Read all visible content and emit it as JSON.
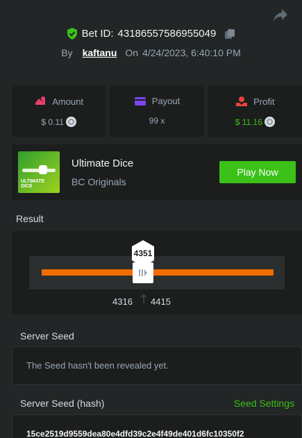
{
  "header": {
    "bet_id_label": "Bet ID:",
    "bet_id": "43186557586955049",
    "by_label": "By",
    "username": "kaftanu",
    "on_label": "On",
    "datetime": "4/24/2023, 6:40:10 PM"
  },
  "stats": [
    {
      "label": "Amount",
      "value": "$ 0.11",
      "icon": "amount-icon"
    },
    {
      "label": "Payout",
      "value": "99 x",
      "icon": "payout-icon"
    },
    {
      "label": "Profit",
      "value": "$ 11.16",
      "icon": "profit-icon"
    }
  ],
  "game": {
    "name": "Ultimate Dice",
    "provider": "BC Originals",
    "play_label": "Play Now",
    "thumb_label_line1": "ULTIMATE",
    "thumb_label_line2": "DICE"
  },
  "result": {
    "label": "Result",
    "value": "4351",
    "range_low": "4316",
    "range_high": "4415"
  },
  "server_seed": {
    "label": "Server Seed",
    "message": "The Seed hasn't been revealed yet."
  },
  "server_seed_hash": {
    "label": "Server Seed (hash)",
    "settings_link": "Seed Settings",
    "hash": "15ce2519d9559dea80e4dfd39c2e4f49de401d6fc10350f2"
  },
  "colors": {
    "background": "#232626",
    "panel": "#1c1e1e",
    "accent_green": "#3bc117",
    "slider_orange": "#f36c00",
    "muted_text": "#98a7b5"
  }
}
